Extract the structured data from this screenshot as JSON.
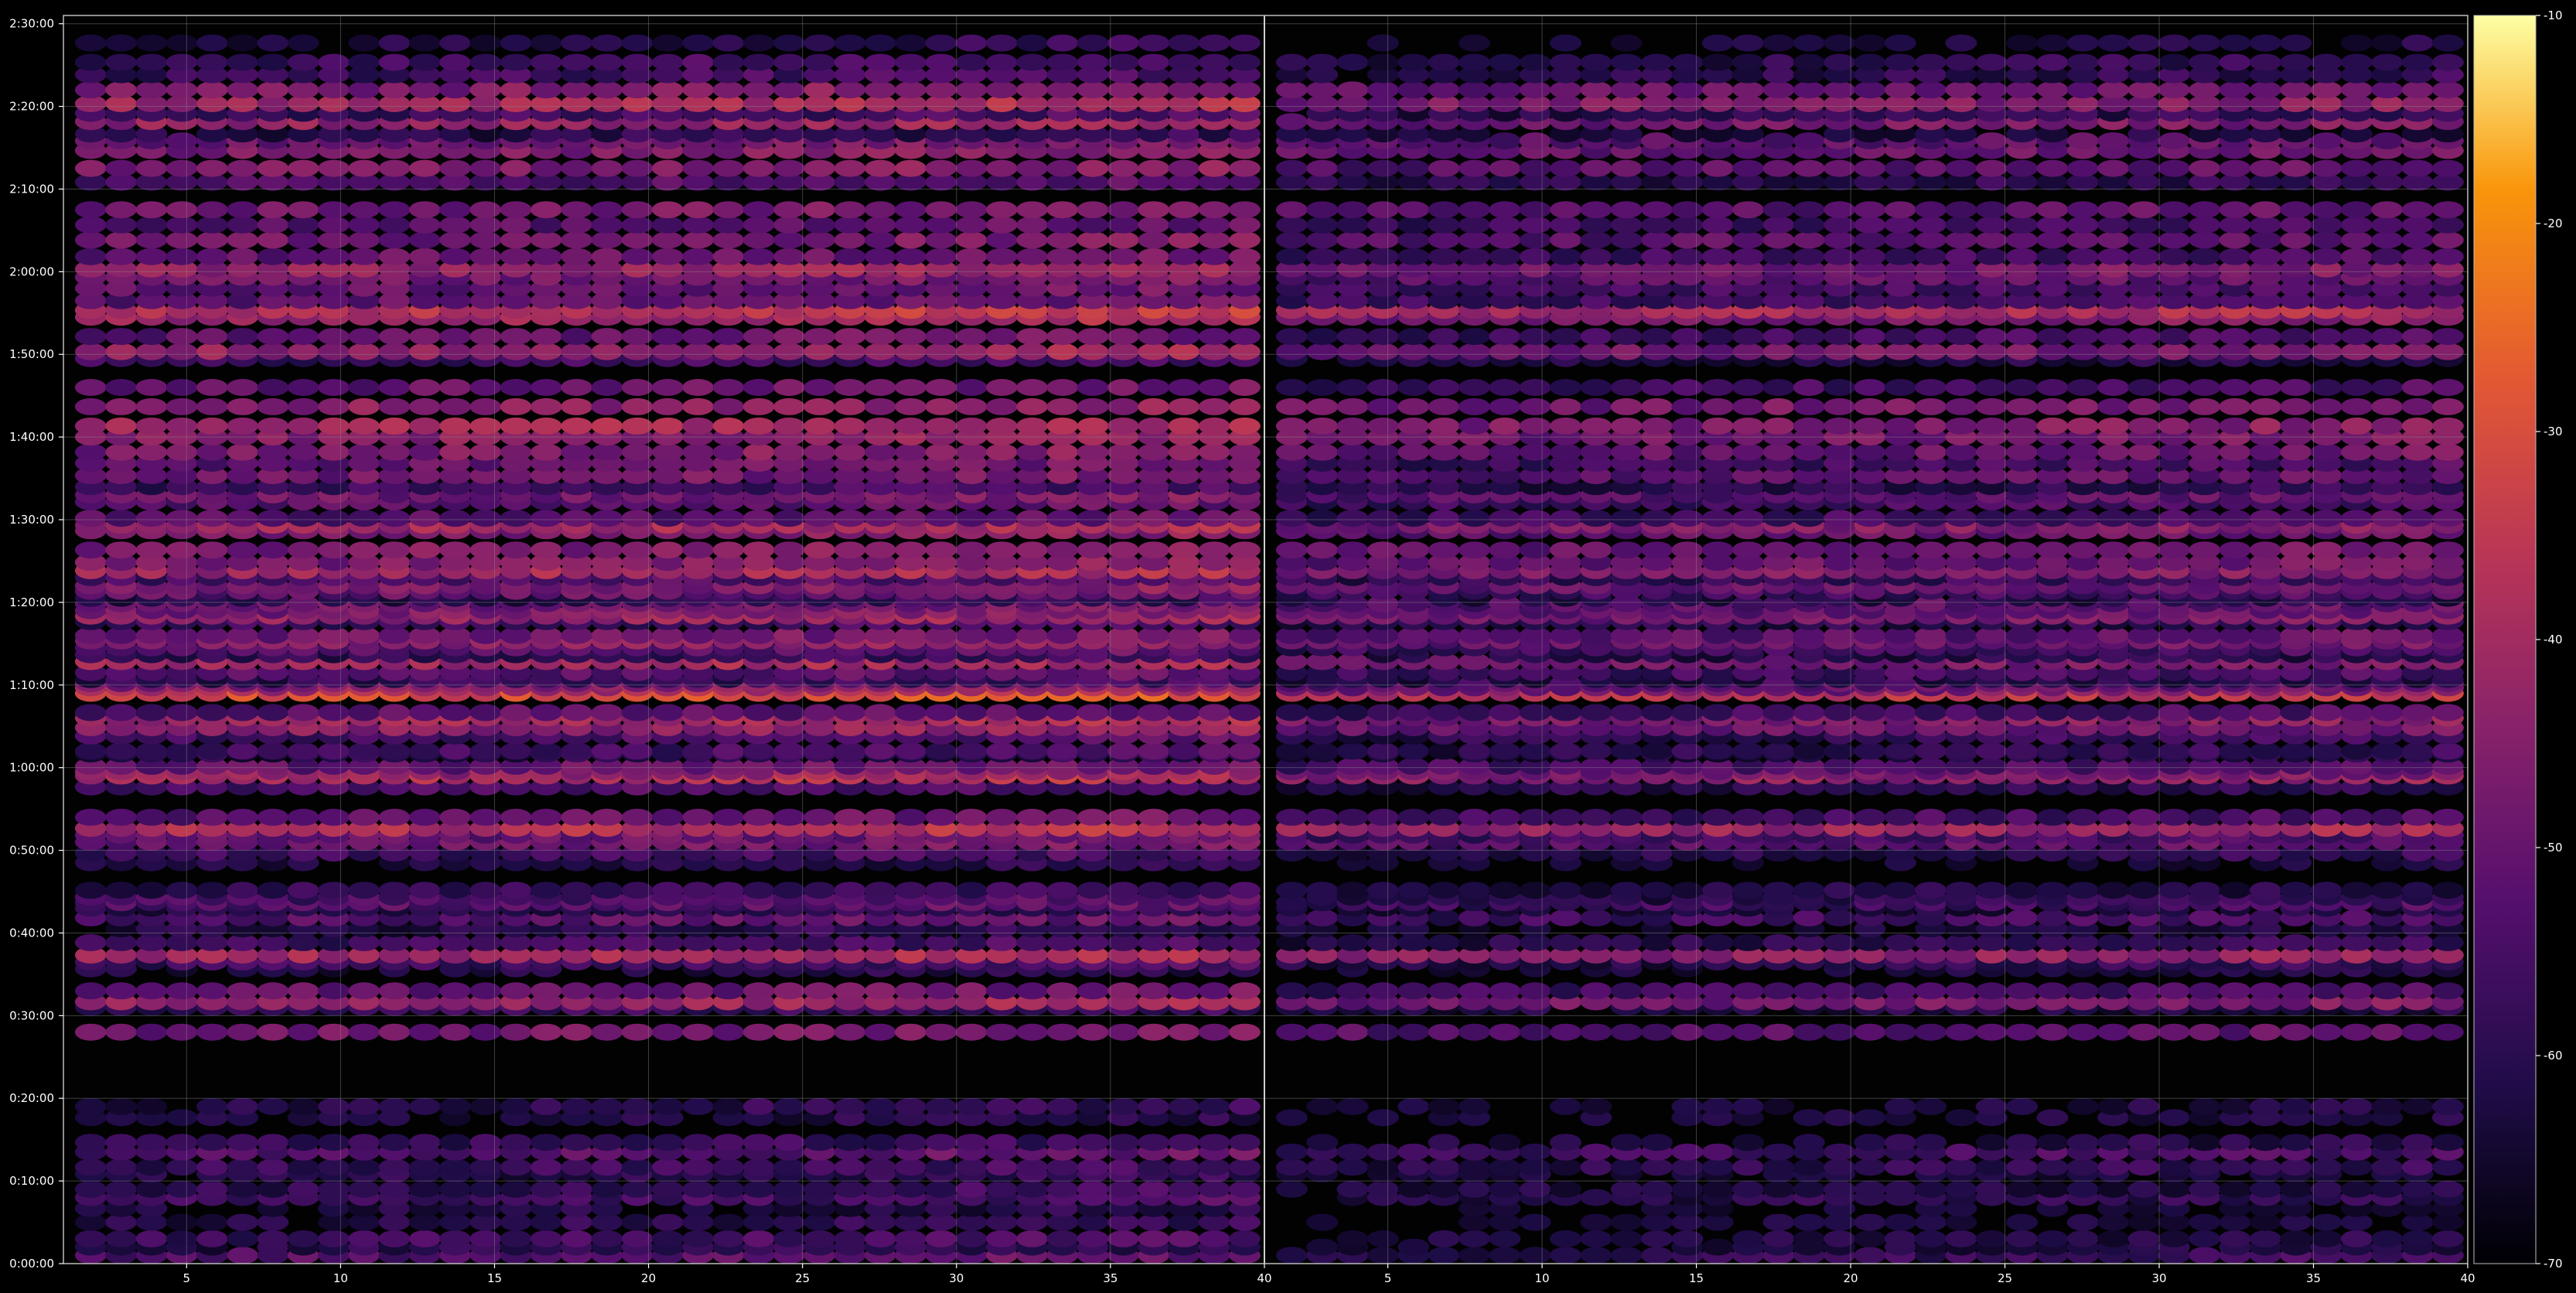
{
  "chart_data": {
    "type": "heatmap",
    "title": "",
    "panels": [
      {
        "name": "",
        "x_range": [
          1,
          40
        ]
      },
      {
        "name": "",
        "x_range": [
          1,
          40
        ]
      }
    ],
    "x_ticks": [
      "5",
      "10",
      "15",
      "20",
      "25",
      "30",
      "35",
      "40"
    ],
    "x_tick_values": [
      5,
      10,
      15,
      20,
      25,
      30,
      35,
      40
    ],
    "y_ticks": [
      "0:00:00",
      "0:10:00",
      "0:20:00",
      "0:30:00",
      "0:40:00",
      "0:50:00",
      "1:00:00",
      "1:10:00",
      "1:20:00",
      "1:30:00",
      "1:40:00",
      "1:50:00",
      "2:00:00",
      "2:10:00",
      "2:20:00",
      "2:30:00"
    ],
    "y_tick_seconds": [
      0,
      600,
      1200,
      1800,
      2400,
      3000,
      3600,
      4200,
      4800,
      5400,
      6000,
      6600,
      7200,
      7800,
      8400,
      9000
    ],
    "y_range_seconds": [
      0,
      9060
    ],
    "colorbar": {
      "ticks": [
        "-10",
        "-20",
        "-30",
        "-40",
        "-50",
        "-60",
        "-70"
      ],
      "tick_values": [
        -10,
        -20,
        -30,
        -40,
        -50,
        -60,
        -70
      ],
      "range": [
        -70,
        -10
      ],
      "colormap": "inferno"
    },
    "columns_per_panel": 39,
    "band_seconds": [
      60,
      120,
      180,
      300,
      400,
      480,
      540,
      650,
      700,
      810,
      880,
      1060,
      1140,
      1680,
      1860,
      1900,
      1980,
      2140,
      2190,
      2240,
      2330,
      2430,
      2510,
      2580,
      2620,
      2660,
      2710,
      2910,
      2980,
      3060,
      3110,
      3160,
      3240,
      3460,
      3540,
      3570,
      3610,
      3700,
      3720,
      3830,
      3890,
      3960,
      4000,
      4140,
      4180,
      4210,
      4240,
      4290,
      4370,
      4420,
      4470,
      4520,
      4560,
      4660,
      4700,
      4740,
      4790,
      4830,
      4880,
      4920,
      4980,
      5030,
      5090,
      5180,
      5320,
      5360,
      5410,
      5530,
      5580,
      5640,
      5720,
      5810,
      5890,
      6000,
      6080,
      6220,
      6360,
      6570,
      6620,
      6730,
      6870,
      6920,
      6990,
      7080,
      7160,
      7220,
      7310,
      7430,
      7540,
      7650,
      7850,
      7950,
      8080,
      8150,
      8200,
      8290,
      8350,
      8420,
      8520,
      8630,
      8720,
      8860
    ],
    "band_levels_panel_1": [
      -52,
      -60,
      -56,
      -60,
      -62,
      -56,
      -58,
      -60,
      -57,
      -52,
      -58,
      -62,
      -60,
      -48,
      -58,
      -42,
      -50,
      -62,
      -56,
      -40,
      -56,
      -60,
      -52,
      -60,
      -52,
      -54,
      -58,
      -62,
      -56,
      -48,
      -50,
      -38,
      -50,
      -54,
      -38,
      -42,
      -50,
      -60,
      -56,
      -54,
      -44,
      -40,
      -52,
      -30,
      -40,
      -46,
      -58,
      -52,
      -40,
      -58,
      -52,
      -44,
      -48,
      -56,
      -42,
      -46,
      -48,
      -60,
      -50,
      -46,
      -54,
      -40,
      -46,
      -46,
      -46,
      -40,
      -52,
      -52,
      -48,
      -56,
      -48,
      -50,
      -46,
      -44,
      -40,
      -44,
      -50,
      -56,
      -42,
      -50,
      -40,
      -36,
      -50,
      -50,
      -48,
      -42,
      -50,
      -48,
      -52,
      -48,
      -54,
      -46,
      -46,
      -48,
      -60,
      -42,
      -56,
      -40,
      -46,
      -56,
      -56,
      -60
    ],
    "band_levels_panel_2": [
      -58,
      -64,
      -62,
      -64,
      -66,
      -60,
      -62,
      -64,
      -60,
      -56,
      -62,
      -64,
      -64,
      -52,
      -62,
      -48,
      -56,
      -64,
      -60,
      -44,
      -60,
      -64,
      -56,
      -64,
      -56,
      -60,
      -62,
      -66,
      -60,
      -52,
      -56,
      -42,
      -56,
      -60,
      -44,
      -48,
      -54,
      -64,
      -60,
      -58,
      -50,
      -46,
      -56,
      -36,
      -48,
      -52,
      -62,
      -56,
      -48,
      -62,
      -56,
      -50,
      -52,
      -60,
      -48,
      -50,
      -52,
      -64,
      -56,
      -50,
      -58,
      -46,
      -50,
      -50,
      -50,
      -46,
      -56,
      -56,
      -52,
      -60,
      -52,
      -56,
      -50,
      -48,
      -46,
      -48,
      -56,
      -62,
      -48,
      -56,
      -46,
      -40,
      -56,
      -56,
      -52,
      -48,
      -56,
      -52,
      -56,
      -52,
      -60,
      -52,
      -50,
      -52,
      -64,
      -48,
      -60,
      -46,
      -50,
      -60,
      -60,
      -64
    ]
  }
}
